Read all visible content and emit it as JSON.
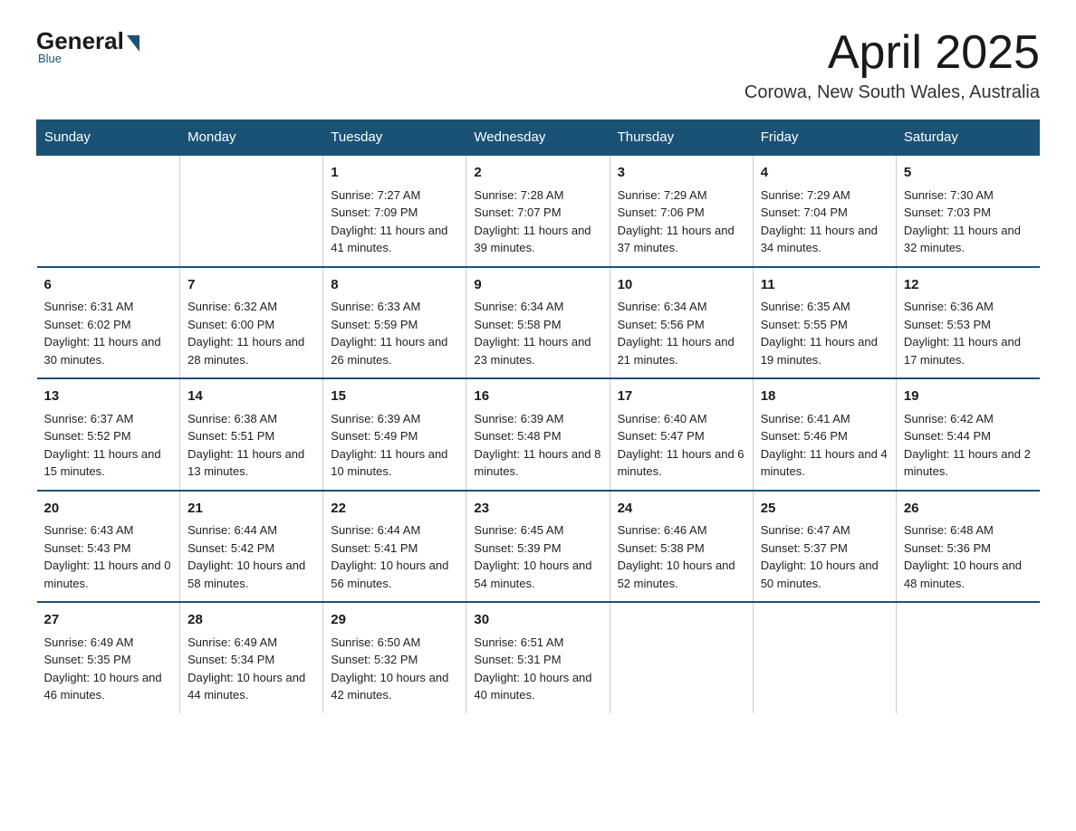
{
  "logo": {
    "general": "General",
    "blue": "Blue",
    "tagline": "Blue"
  },
  "header": {
    "title": "April 2025",
    "subtitle": "Corowa, New South Wales, Australia"
  },
  "weekdays": [
    "Sunday",
    "Monday",
    "Tuesday",
    "Wednesday",
    "Thursday",
    "Friday",
    "Saturday"
  ],
  "weeks": [
    [
      {
        "day": "",
        "sunrise": "",
        "sunset": "",
        "daylight": ""
      },
      {
        "day": "",
        "sunrise": "",
        "sunset": "",
        "daylight": ""
      },
      {
        "day": "1",
        "sunrise": "Sunrise: 7:27 AM",
        "sunset": "Sunset: 7:09 PM",
        "daylight": "Daylight: 11 hours and 41 minutes."
      },
      {
        "day": "2",
        "sunrise": "Sunrise: 7:28 AM",
        "sunset": "Sunset: 7:07 PM",
        "daylight": "Daylight: 11 hours and 39 minutes."
      },
      {
        "day": "3",
        "sunrise": "Sunrise: 7:29 AM",
        "sunset": "Sunset: 7:06 PM",
        "daylight": "Daylight: 11 hours and 37 minutes."
      },
      {
        "day": "4",
        "sunrise": "Sunrise: 7:29 AM",
        "sunset": "Sunset: 7:04 PM",
        "daylight": "Daylight: 11 hours and 34 minutes."
      },
      {
        "day": "5",
        "sunrise": "Sunrise: 7:30 AM",
        "sunset": "Sunset: 7:03 PM",
        "daylight": "Daylight: 11 hours and 32 minutes."
      }
    ],
    [
      {
        "day": "6",
        "sunrise": "Sunrise: 6:31 AM",
        "sunset": "Sunset: 6:02 PM",
        "daylight": "Daylight: 11 hours and 30 minutes."
      },
      {
        "day": "7",
        "sunrise": "Sunrise: 6:32 AM",
        "sunset": "Sunset: 6:00 PM",
        "daylight": "Daylight: 11 hours and 28 minutes."
      },
      {
        "day": "8",
        "sunrise": "Sunrise: 6:33 AM",
        "sunset": "Sunset: 5:59 PM",
        "daylight": "Daylight: 11 hours and 26 minutes."
      },
      {
        "day": "9",
        "sunrise": "Sunrise: 6:34 AM",
        "sunset": "Sunset: 5:58 PM",
        "daylight": "Daylight: 11 hours and 23 minutes."
      },
      {
        "day": "10",
        "sunrise": "Sunrise: 6:34 AM",
        "sunset": "Sunset: 5:56 PM",
        "daylight": "Daylight: 11 hours and 21 minutes."
      },
      {
        "day": "11",
        "sunrise": "Sunrise: 6:35 AM",
        "sunset": "Sunset: 5:55 PM",
        "daylight": "Daylight: 11 hours and 19 minutes."
      },
      {
        "day": "12",
        "sunrise": "Sunrise: 6:36 AM",
        "sunset": "Sunset: 5:53 PM",
        "daylight": "Daylight: 11 hours and 17 minutes."
      }
    ],
    [
      {
        "day": "13",
        "sunrise": "Sunrise: 6:37 AM",
        "sunset": "Sunset: 5:52 PM",
        "daylight": "Daylight: 11 hours and 15 minutes."
      },
      {
        "day": "14",
        "sunrise": "Sunrise: 6:38 AM",
        "sunset": "Sunset: 5:51 PM",
        "daylight": "Daylight: 11 hours and 13 minutes."
      },
      {
        "day": "15",
        "sunrise": "Sunrise: 6:39 AM",
        "sunset": "Sunset: 5:49 PM",
        "daylight": "Daylight: 11 hours and 10 minutes."
      },
      {
        "day": "16",
        "sunrise": "Sunrise: 6:39 AM",
        "sunset": "Sunset: 5:48 PM",
        "daylight": "Daylight: 11 hours and 8 minutes."
      },
      {
        "day": "17",
        "sunrise": "Sunrise: 6:40 AM",
        "sunset": "Sunset: 5:47 PM",
        "daylight": "Daylight: 11 hours and 6 minutes."
      },
      {
        "day": "18",
        "sunrise": "Sunrise: 6:41 AM",
        "sunset": "Sunset: 5:46 PM",
        "daylight": "Daylight: 11 hours and 4 minutes."
      },
      {
        "day": "19",
        "sunrise": "Sunrise: 6:42 AM",
        "sunset": "Sunset: 5:44 PM",
        "daylight": "Daylight: 11 hours and 2 minutes."
      }
    ],
    [
      {
        "day": "20",
        "sunrise": "Sunrise: 6:43 AM",
        "sunset": "Sunset: 5:43 PM",
        "daylight": "Daylight: 11 hours and 0 minutes."
      },
      {
        "day": "21",
        "sunrise": "Sunrise: 6:44 AM",
        "sunset": "Sunset: 5:42 PM",
        "daylight": "Daylight: 10 hours and 58 minutes."
      },
      {
        "day": "22",
        "sunrise": "Sunrise: 6:44 AM",
        "sunset": "Sunset: 5:41 PM",
        "daylight": "Daylight: 10 hours and 56 minutes."
      },
      {
        "day": "23",
        "sunrise": "Sunrise: 6:45 AM",
        "sunset": "Sunset: 5:39 PM",
        "daylight": "Daylight: 10 hours and 54 minutes."
      },
      {
        "day": "24",
        "sunrise": "Sunrise: 6:46 AM",
        "sunset": "Sunset: 5:38 PM",
        "daylight": "Daylight: 10 hours and 52 minutes."
      },
      {
        "day": "25",
        "sunrise": "Sunrise: 6:47 AM",
        "sunset": "Sunset: 5:37 PM",
        "daylight": "Daylight: 10 hours and 50 minutes."
      },
      {
        "day": "26",
        "sunrise": "Sunrise: 6:48 AM",
        "sunset": "Sunset: 5:36 PM",
        "daylight": "Daylight: 10 hours and 48 minutes."
      }
    ],
    [
      {
        "day": "27",
        "sunrise": "Sunrise: 6:49 AM",
        "sunset": "Sunset: 5:35 PM",
        "daylight": "Daylight: 10 hours and 46 minutes."
      },
      {
        "day": "28",
        "sunrise": "Sunrise: 6:49 AM",
        "sunset": "Sunset: 5:34 PM",
        "daylight": "Daylight: 10 hours and 44 minutes."
      },
      {
        "day": "29",
        "sunrise": "Sunrise: 6:50 AM",
        "sunset": "Sunset: 5:32 PM",
        "daylight": "Daylight: 10 hours and 42 minutes."
      },
      {
        "day": "30",
        "sunrise": "Sunrise: 6:51 AM",
        "sunset": "Sunset: 5:31 PM",
        "daylight": "Daylight: 10 hours and 40 minutes."
      },
      {
        "day": "",
        "sunrise": "",
        "sunset": "",
        "daylight": ""
      },
      {
        "day": "",
        "sunrise": "",
        "sunset": "",
        "daylight": ""
      },
      {
        "day": "",
        "sunrise": "",
        "sunset": "",
        "daylight": ""
      }
    ]
  ]
}
